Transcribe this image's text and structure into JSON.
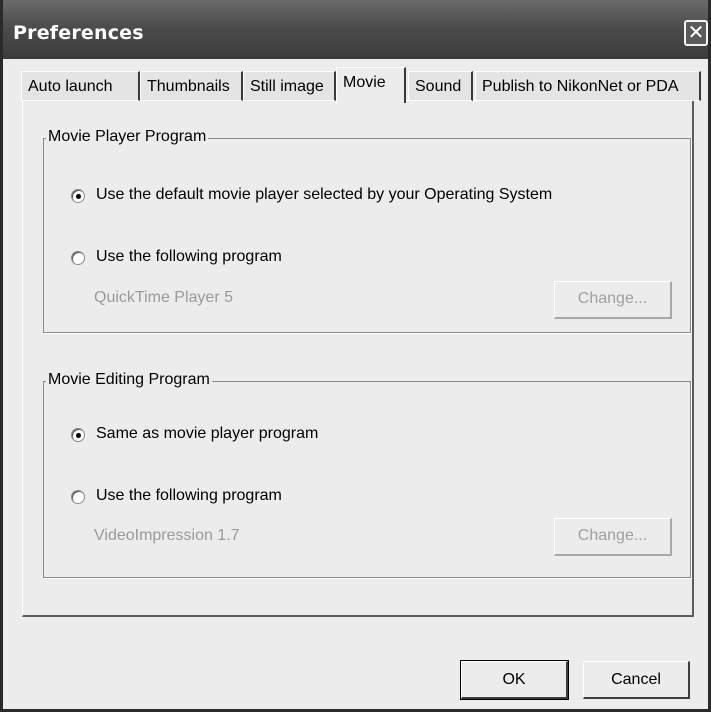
{
  "window": {
    "title": "Preferences",
    "close_glyph": "✕"
  },
  "tabs": [
    {
      "label": "Auto launch",
      "active": false
    },
    {
      "label": "Thumbnails",
      "active": false
    },
    {
      "label": "Still image",
      "active": false
    },
    {
      "label": "Movie",
      "active": true
    },
    {
      "label": "Sound",
      "active": false
    },
    {
      "label": "Publish to NikonNet or PDA",
      "active": false
    }
  ],
  "player_group": {
    "legend": "Movie Player Program",
    "option_default": "Use the default movie player selected by your Operating System",
    "option_custom": "Use the following program",
    "selected": "default",
    "program_name": "QuickTime Player 5",
    "change_label": "Change..."
  },
  "editing_group": {
    "legend": "Movie Editing Program",
    "option_same": "Same as movie player program",
    "option_custom": "Use the following program",
    "selected": "same",
    "program_name": "VideoImpression 1.7",
    "change_label": "Change..."
  },
  "footer": {
    "ok_label": "OK",
    "cancel_label": "Cancel"
  }
}
